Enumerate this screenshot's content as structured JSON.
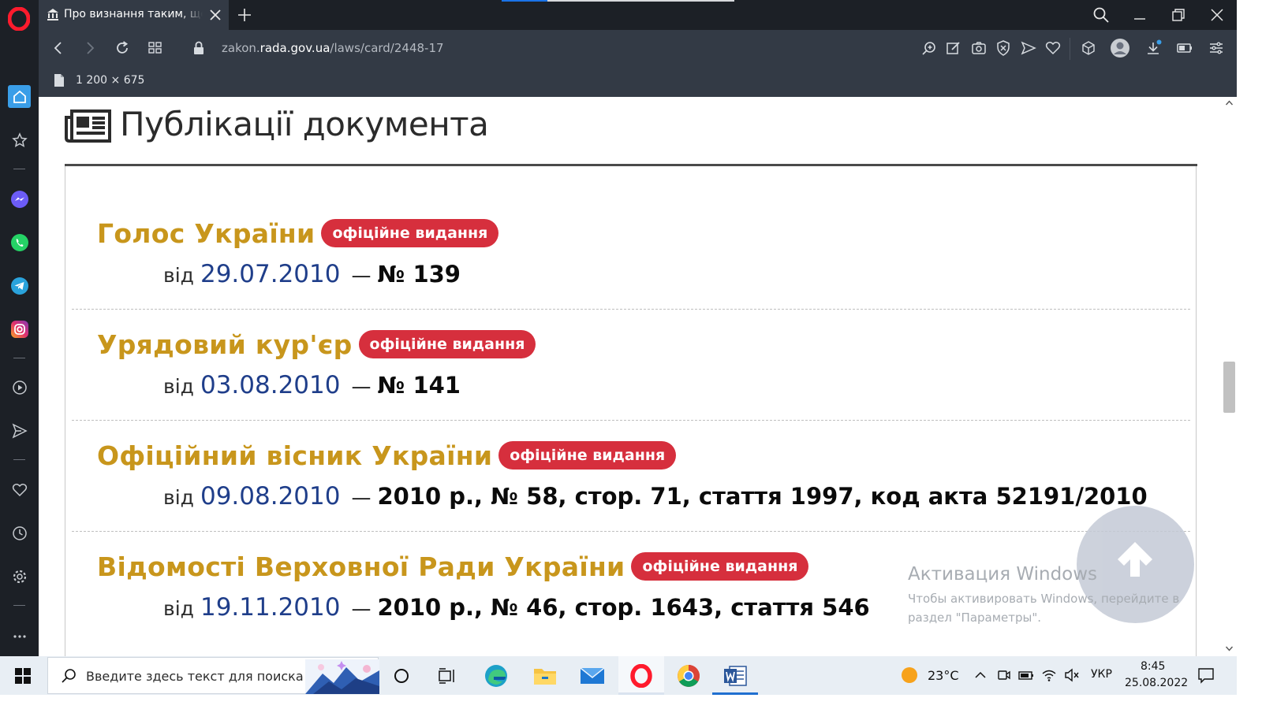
{
  "browser": {
    "tab_title": "Про визнання таким, що втратив чинність",
    "url_prefix": "zakon.",
    "url_domain": "rada.gov.ua",
    "url_path": "/laws/card/2448-17",
    "image_info": "1 200 × 675"
  },
  "page": {
    "heading": "Публікації документа",
    "badge_label": "офіційне видання",
    "from_word": "від",
    "dash": "—",
    "publications": [
      {
        "name": "Голос України",
        "date": "29.07.2010",
        "number": "№ 139"
      },
      {
        "name": "Урядовий кур'єр",
        "date": "03.08.2010",
        "number": "№ 141"
      },
      {
        "name": "Офіційний вісник України",
        "date": "09.08.2010",
        "number": "2010 р., № 58, стор. 71, стаття 1997, код акта 52191/2010"
      },
      {
        "name": "Відомості Верховної Ради України",
        "date": "19.11.2010",
        "number": "2010 р., № 46, стор. 1643, стаття 546"
      }
    ]
  },
  "watermark": {
    "title": "Активация Windows",
    "text": "Чтобы активировать Windows, перейдите в раздел \"Параметры\"."
  },
  "taskbar": {
    "search_placeholder": "Введите здесь текст для поиска",
    "weather": "23°C",
    "language": "УКР",
    "time": "8:45",
    "date": "25.08.2022"
  },
  "colors": {
    "publication_name": "#c8961c",
    "badge": "#d62f3d",
    "date": "#1f3e8a",
    "browser_chrome": "#333a45",
    "sidebar": "#1c2026"
  },
  "icons": {
    "sidebar": [
      "home-icon",
      "star-icon",
      "messenger-icon",
      "whatsapp-icon",
      "telegram-icon",
      "instagram-icon",
      "player-icon",
      "send-icon",
      "heart-icon",
      "history-icon",
      "settings-icon",
      "more-icon"
    ]
  }
}
